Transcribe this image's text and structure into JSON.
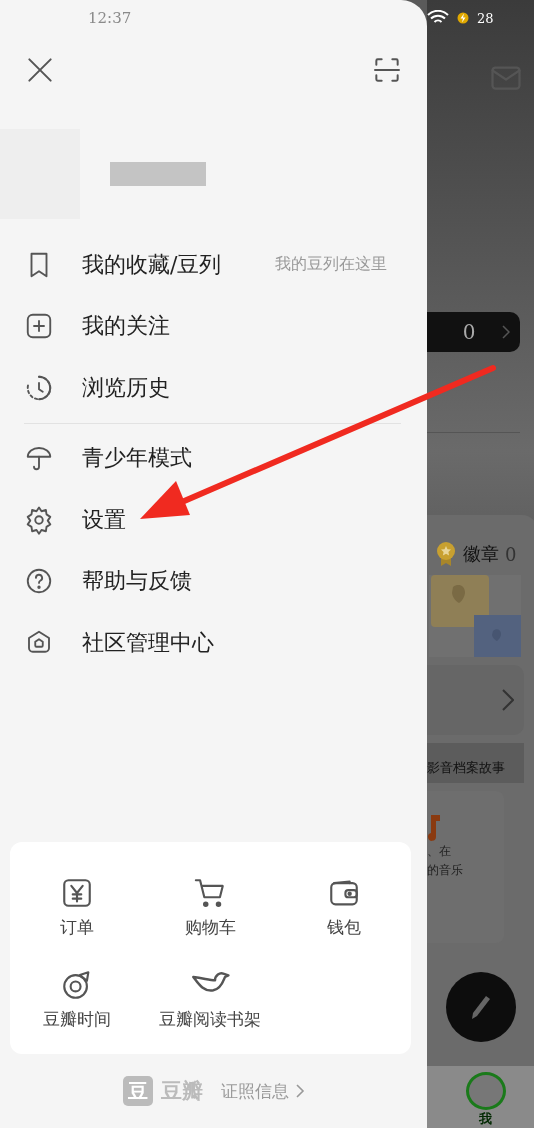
{
  "status_bar": {
    "time": "12:37",
    "battery": "28"
  },
  "menu_groups": [
    [
      {
        "kind": "bookmark",
        "label": "我的收藏/豆列",
        "hint": "我的豆列在这里"
      },
      {
        "kind": "plus",
        "label": "我的关注"
      },
      {
        "kind": "history",
        "label": "浏览历史"
      }
    ],
    [
      {
        "kind": "umbrella",
        "label": "青少年模式"
      },
      {
        "kind": "gear",
        "label": "设置"
      },
      {
        "kind": "help",
        "label": "帮助与反馈"
      },
      {
        "kind": "shield",
        "label": "社区管理中心"
      }
    ]
  ],
  "shortcuts": [
    {
      "kind": "yen",
      "label": "订单"
    },
    {
      "kind": "cart",
      "label": "购物车"
    },
    {
      "kind": "wallet",
      "label": "钱包"
    },
    {
      "kind": "ring",
      "label": "豆瓣时间"
    },
    {
      "kind": "bird",
      "label": "豆瓣阅读书架"
    }
  ],
  "footer": {
    "logo_mark": "豆",
    "logo_text": "豆瓣",
    "link": "证照信息"
  },
  "background": {
    "count": "0",
    "badge_label": "徽章",
    "badge_count": "0",
    "strip_text": "影音档案故事",
    "card_text_1": "、在",
    "card_text_2": "的音乐",
    "tab_label": "我"
  }
}
